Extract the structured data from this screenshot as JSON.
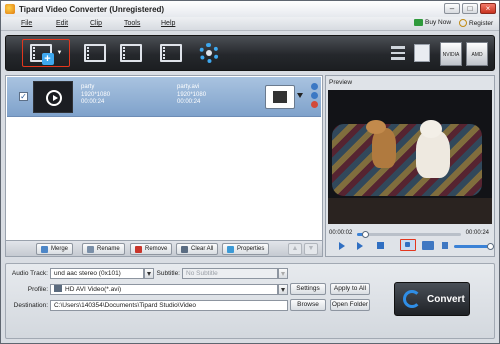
{
  "window": {
    "title": "Tipard Video Converter (Unregistered)",
    "controls": {
      "minimize": "–",
      "maximize": "□",
      "close": "×"
    }
  },
  "menu": {
    "items": [
      "File",
      "Edit",
      "Clip",
      "Tools",
      "Help"
    ],
    "buy_now": "Buy Now",
    "register": "Register"
  },
  "toolbar": {
    "icons": [
      "add-file-icon",
      "edit-icon",
      "clip-icon",
      "3d-icon",
      "settings-gear-icon"
    ],
    "gpu_badges": [
      "NVIDIA",
      "AMD"
    ]
  },
  "file_list": {
    "rows": [
      {
        "checked": "✓",
        "source_name": "party",
        "source_res": "1920*1080",
        "source_dur": "00:00:24",
        "output_name": "party.avi",
        "output_res": "1920*1080",
        "output_dur": "00:00:24"
      }
    ],
    "actions": {
      "merge": "Merge",
      "rename": "Rename",
      "remove": "Remove",
      "clear_all": "Clear All",
      "properties": "Properties",
      "up": "▲",
      "down": "▼"
    }
  },
  "preview": {
    "label": "Preview",
    "current_time": "00:00:02",
    "total_time": "00:00:24",
    "progress": 0.08,
    "volume": 1.0
  },
  "settings": {
    "audio_track_label": "Audio Track:",
    "audio_track_value": "und aac stereo (0x101)",
    "subtitle_label": "Subtitle:",
    "subtitle_value": "No Subtitle",
    "profile_label": "Profile:",
    "profile_value": "HD AVI Video(*.avi)",
    "destination_label": "Destination:",
    "destination_value": "C:\\Users\\140354\\Documents\\Tipard Studio\\Video",
    "settings_btn": "Settings",
    "apply_all_btn": "Apply to All",
    "browse_btn": "Browse",
    "open_folder_btn": "Open Folder",
    "convert_btn": "Convert"
  }
}
